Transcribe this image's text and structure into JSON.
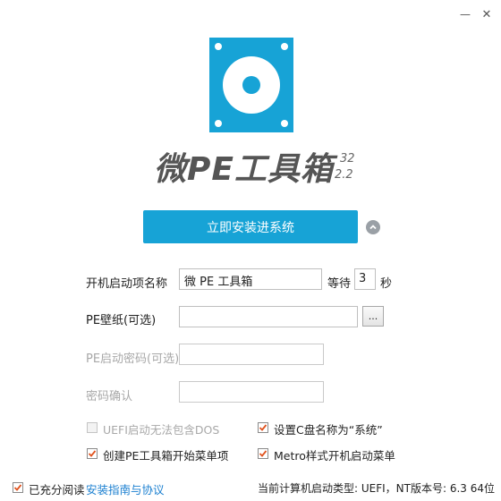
{
  "window": {
    "minimize_glyph": "—",
    "close_glyph": "✕"
  },
  "logo": {
    "icon": "disc-icon",
    "color": "#17a3d6"
  },
  "app": {
    "title": "微PE工具箱",
    "arch": "32",
    "version": "2.2"
  },
  "install_button": {
    "label": "立即安装进系统"
  },
  "form": {
    "boot_name_label": "开机启动项名称",
    "boot_name_value": "微 PE 工具箱",
    "wait_label": "等待",
    "wait_value": "3",
    "seconds_label": "秒",
    "wallpaper_label": "PE壁纸(可选)",
    "wallpaper_value": "",
    "browse_label": "...",
    "password_label": "PE启动密码(可选)",
    "password_value": "",
    "confirm_label": "密码确认",
    "confirm_value": ""
  },
  "options": [
    {
      "label": "UEFI启动无法包含DOS",
      "checked": false,
      "disabled": true
    },
    {
      "label": "设置C盘名称为“系统”",
      "checked": true,
      "disabled": false
    },
    {
      "label": "创建PE工具箱开始菜单项",
      "checked": true,
      "disabled": false
    },
    {
      "label": "Metro样式开机启动菜单",
      "checked": true,
      "disabled": false
    }
  ],
  "footer": {
    "agree_label": "已充分阅读",
    "agree_checked": true,
    "guide_link": "安装指南与协议",
    "status": "当前计算机启动类型: UEFI，NT版本号: 6.3 64位"
  },
  "colors": {
    "accent": "#17a3d6",
    "check": "#e0531f",
    "link": "#1a7fd0"
  }
}
